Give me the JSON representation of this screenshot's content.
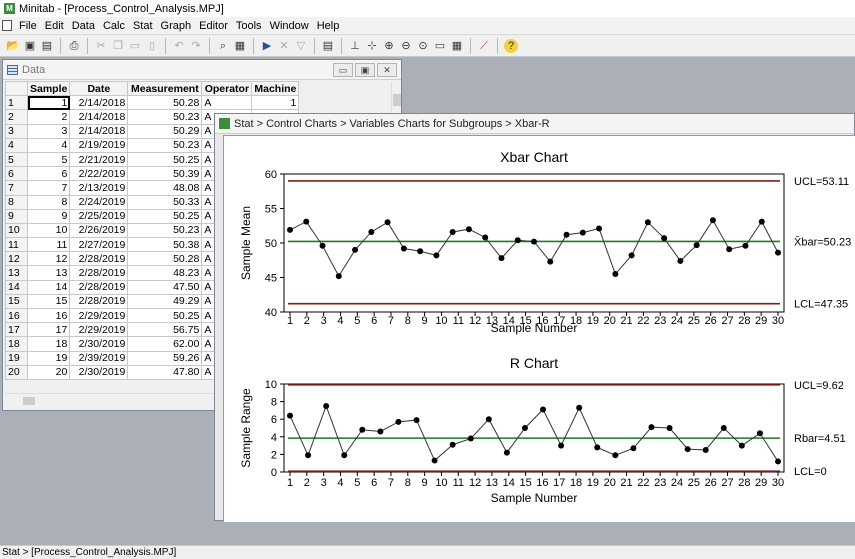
{
  "app": {
    "title": "Minitab - [Process_Control_Analysis.MPJ]",
    "icon": "minitab-icon"
  },
  "menu": [
    "File",
    "Edit",
    "Data",
    "Calc",
    "Stat",
    "Graph",
    "Editor",
    "Tools",
    "Window",
    "Help"
  ],
  "toolbar_icons": [
    "open-icon",
    "save-icon",
    "save-project-icon",
    "print-icon",
    "cut-icon",
    "copy-icon",
    "paste-icon",
    "paste-special-icon",
    "undo-icon",
    "redo-icon",
    "find-icon",
    "worksheet-icon",
    "run-icon",
    "cancel-icon",
    "filter-icon",
    "session-icon",
    "brush-icon",
    "crosshair-icon",
    "zoom-in-icon",
    "zoom-out-icon",
    "zoom-icon",
    "window-icon",
    "table-icon",
    "graph-icon",
    "help-icon"
  ],
  "data_window": {
    "title": "Data",
    "columns": [
      "Sample",
      "Date",
      "Measurement",
      "Operator",
      "Machine"
    ],
    "rows": [
      [
        "1",
        "1",
        "2/14/2018",
        "50.28",
        "A",
        "1"
      ],
      [
        "2",
        "2",
        "2/14/2018",
        "50.23",
        "A",
        ""
      ],
      [
        "3",
        "3",
        "2/14/2018",
        "50.29",
        "A",
        ""
      ],
      [
        "4",
        "4",
        "2/19/2019",
        "50.23",
        "A",
        ""
      ],
      [
        "5",
        "5",
        "2/21/2019",
        "50.25",
        "A",
        ""
      ],
      [
        "6",
        "6",
        "2/22/2019",
        "50.39",
        "A",
        ""
      ],
      [
        "7",
        "7",
        "2/13/2019",
        "48.08",
        "A",
        ""
      ],
      [
        "8",
        "8",
        "2/24/2019",
        "50.33",
        "A",
        ""
      ],
      [
        "9",
        "9",
        "2/25/2019",
        "50.25",
        "A",
        ""
      ],
      [
        "10",
        "10",
        "2/26/2019",
        "50.23",
        "A",
        ""
      ],
      [
        "11",
        "11",
        "2/27/2019",
        "50.38",
        "A",
        ""
      ],
      [
        "12",
        "12",
        "2/28/2019",
        "50.28",
        "A",
        ""
      ],
      [
        "13",
        "13",
        "2/28/2019",
        "48.23",
        "A",
        ""
      ],
      [
        "14",
        "14",
        "2/28/2019",
        "47.50",
        "A",
        ""
      ],
      [
        "15",
        "15",
        "2/28/2019",
        "49.29",
        "A",
        ""
      ],
      [
        "16",
        "16",
        "2/29/2019",
        "50.25",
        "A",
        ""
      ],
      [
        "17",
        "17",
        "2/29/2019",
        "56.75",
        "A",
        ""
      ],
      [
        "18",
        "18",
        "2/30/2019",
        "62.00",
        "A",
        ""
      ],
      [
        "19",
        "19",
        "2/39/2019",
        "59.26",
        "A",
        ""
      ],
      [
        "20",
        "20",
        "2/30/2019",
        "47.80",
        "A",
        ""
      ]
    ]
  },
  "chart_window": {
    "title": "Stat > Control Charts > Variables Charts for Subgroups > Xbar-R"
  },
  "status": "Stat > [Process_Control_Analysis.MPJ]",
  "colors": {
    "limit": "#8b1a1a",
    "center": "#1e7a1e",
    "series": "#333333"
  },
  "chart_data": [
    {
      "type": "line",
      "title": "Xbar Chart",
      "xlabel": "Sample Number",
      "ylabel": "Sample Mean",
      "x": [
        1,
        2,
        3,
        4,
        5,
        6,
        7,
        8,
        9,
        10,
        11,
        12,
        13,
        14,
        15,
        16,
        17,
        18,
        19,
        20,
        21,
        22,
        23,
        24,
        25,
        26,
        27,
        28,
        29,
        30
      ],
      "values": [
        51.9,
        53.1,
        49.6,
        45.2,
        49.0,
        51.6,
        53.0,
        49.2,
        48.8,
        48.2,
        51.6,
        52.0,
        50.8,
        47.8,
        50.4,
        50.2,
        47.3,
        51.2,
        51.5,
        52.1,
        45.5,
        48.2,
        53.0,
        50.7,
        47.4,
        49.7,
        53.3,
        49.1,
        49.6,
        53.1,
        48.6
      ],
      "ylim": [
        40,
        60
      ],
      "yticks": [
        40,
        45,
        50,
        55,
        60
      ],
      "ucl": 59.0,
      "cl": 50.23,
      "lcl": 41.2,
      "labels": {
        "ucl": "UCL=53.11",
        "cl": "X̄bar=50.23",
        "lcl": "LCL=47.35"
      }
    },
    {
      "type": "line",
      "title": "R Chart",
      "xlabel": "Sample Number",
      "ylabel": "Sample Range",
      "x": [
        1,
        2,
        3,
        4,
        5,
        6,
        7,
        8,
        9,
        10,
        11,
        12,
        13,
        14,
        15,
        16,
        17,
        18,
        19,
        20,
        21,
        22,
        23,
        24,
        25,
        26,
        27,
        28,
        29,
        30
      ],
      "values": [
        6.4,
        1.9,
        7.5,
        1.9,
        4.8,
        4.6,
        5.7,
        5.9,
        1.3,
        3.1,
        3.8,
        6.0,
        2.2,
        5.0,
        7.1,
        3.0,
        7.3,
        2.8,
        1.9,
        2.7,
        5.1,
        5.0,
        2.6,
        2.5,
        5.0,
        3.0,
        4.4,
        1.2
      ],
      "ylim": [
        0,
        10
      ],
      "yticks": [
        0,
        2,
        4,
        6,
        8,
        10
      ],
      "ucl": 9.9,
      "cl": 3.85,
      "lcl": 0.1,
      "labels": {
        "ucl": "UCL=9.62",
        "cl": "Rbar=4.51",
        "lcl": "LCL=0"
      }
    }
  ]
}
